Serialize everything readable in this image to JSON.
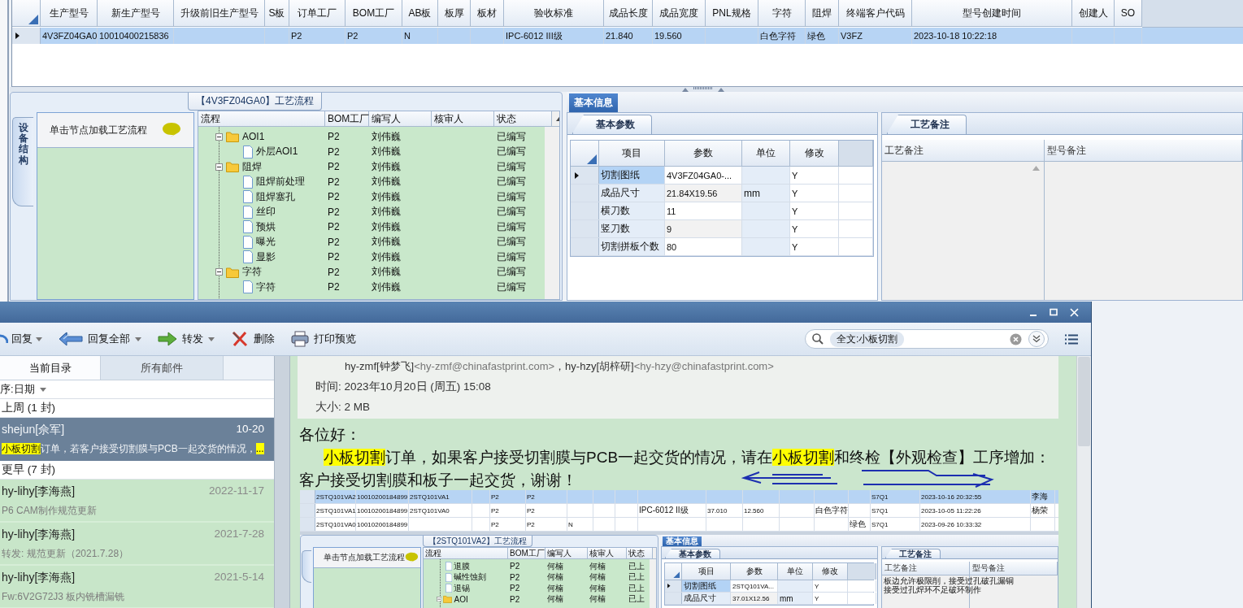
{
  "main_grid": {
    "columns": [
      "生产型号",
      "新生产型号",
      "升级前旧生产型号",
      "S板",
      "订单工厂",
      "BOM工厂",
      "AB板",
      "板厚",
      "板材",
      "验收标准",
      "成品长度",
      "成品宽度",
      "PNL规格",
      "字符",
      "阻焊",
      "终端客户代码",
      "型号创建时间",
      "创建人",
      "SO"
    ],
    "rows": [
      {
        "selected": true,
        "cells": [
          "4V3FZ04GA0",
          "10010400215836",
          null,
          null,
          "P2",
          "P2",
          "N",
          null,
          null,
          "IPC-6012 III级",
          "21.840",
          "19.560",
          null,
          "白色字符",
          "绿色",
          "V3FZ",
          "2023-10-18 10:22:18",
          null,
          null
        ]
      }
    ]
  },
  "flow_panel": {
    "title": "【4V3FZ04GA0】工艺流程",
    "side_tab": "设备结构",
    "hint": "单击节点加载工艺流程",
    "columns": [
      "流程",
      "BOM工厂",
      "编写人",
      "核审人",
      "状态"
    ],
    "tree": [
      {
        "kind": "folder",
        "name": "AOI1",
        "expanded": true,
        "cells": [
          "P2",
          "刘伟巍",
          null,
          "已编写"
        ],
        "children": [
          {
            "kind": "step",
            "name": "外层AOI1",
            "cells": [
              "P2",
              "刘伟巍",
              null,
              "已编写"
            ]
          }
        ]
      },
      {
        "kind": "folder",
        "name": "阻焊",
        "expanded": true,
        "cells": [
          "P2",
          "刘伟巍",
          null,
          "已编写"
        ],
        "children": [
          {
            "kind": "step",
            "name": "阻焊前处理",
            "cells": [
              "P2",
              "刘伟巍",
              null,
              "已编写"
            ]
          },
          {
            "kind": "step",
            "name": "阻焊塞孔",
            "cells": [
              "P2",
              "刘伟巍",
              null,
              "已编写"
            ]
          },
          {
            "kind": "step",
            "name": "丝印",
            "cells": [
              "P2",
              "刘伟巍",
              null,
              "已编写"
            ]
          },
          {
            "kind": "step",
            "name": "预烘",
            "cells": [
              "P2",
              "刘伟巍",
              null,
              "已编写"
            ]
          },
          {
            "kind": "step",
            "name": "曝光",
            "cells": [
              "P2",
              "刘伟巍",
              null,
              "已编写"
            ]
          },
          {
            "kind": "step",
            "name": "显影",
            "cells": [
              "P2",
              "刘伟巍",
              null,
              "已编写"
            ]
          }
        ]
      },
      {
        "kind": "folder",
        "name": "字符",
        "expanded": true,
        "cells": [
          "P2",
          "刘伟巍",
          null,
          "已编写"
        ],
        "children": [
          {
            "kind": "step",
            "name": "字符",
            "cells": [
              "P2",
              "刘伟巍",
              null,
              "已编写"
            ]
          }
        ]
      }
    ]
  },
  "info_panel": {
    "tab": "基本信息",
    "params_tab": "基本参数",
    "columns": [
      "项目",
      "参数",
      "单位",
      "修改"
    ],
    "rows": [
      {
        "selected": true,
        "cells": [
          "切割图纸",
          "4V3FZ04GA0-...",
          null,
          "Y"
        ]
      },
      {
        "selected": false,
        "cells": [
          "成品尺寸",
          "21.84X19.56",
          "mm",
          "Y"
        ]
      },
      {
        "selected": false,
        "cells": [
          "横刀数",
          "11",
          null,
          "Y"
        ]
      },
      {
        "selected": false,
        "cells": [
          "竖刀数",
          "9",
          null,
          "Y"
        ]
      },
      {
        "selected": false,
        "cells": [
          "切割拼板个数",
          "80",
          null,
          "Y"
        ]
      }
    ],
    "notes_tab": "工艺备注",
    "notes_columns": [
      "工艺备注",
      "型号备注"
    ]
  },
  "mail": {
    "toolbar": [
      {
        "kind": "reply",
        "label": "回复",
        "dropdown": true
      },
      {
        "kind": "reply-all",
        "label": "回复全部",
        "dropdown": true
      },
      {
        "kind": "forward",
        "label": "转发",
        "dropdown": true
      },
      {
        "kind": "delete",
        "label": "删除",
        "dropdown": false
      },
      {
        "kind": "print",
        "label": "打印预览",
        "dropdown": false
      }
    ],
    "search": {
      "tag": "全文:小板切割"
    },
    "tabs": [
      {
        "label": "当前目录",
        "selected": true
      },
      {
        "label": "所有邮件",
        "selected": false
      }
    ],
    "sort": "序:日期",
    "groups": [
      {
        "label": "上周 (1 封)",
        "messages": [
          {
            "sender": "shejun[佘军]",
            "date": "10-20",
            "selected": true,
            "preview": [
              {
                "text": "小板切割",
                "highlight": true
              },
              {
                "text": "订单，若客户接受切割膜与PCB一起交货的情况，",
                "highlight": false
              },
              {
                "text": "...",
                "highlight": true
              }
            ]
          }
        ]
      },
      {
        "label": "更早 (7 封)",
        "messages": [
          {
            "sender": "hy-lihy[李海燕]",
            "date": "2022-11-17",
            "selected": false,
            "preview": [
              {
                "text": "P6 CAM制作规范更新",
                "highlight": false
              }
            ]
          },
          {
            "sender": "hy-lihy[李海燕]",
            "date": "2021-7-28",
            "selected": false,
            "preview": [
              {
                "text": "转发: 规范更新（2021.7.28）",
                "highlight": false
              }
            ]
          },
          {
            "sender": "hy-lihy[李海燕]",
            "date": "2021-5-14",
            "selected": false,
            "preview": [
              {
                "text": "Fw:6V2G72J3 板内铣槽漏铣",
                "highlight": false
              }
            ]
          }
        ]
      }
    ],
    "reader": {
      "recipients": [
        {
          "text": "hy-zmf[钟梦飞]",
          "kind": "name"
        },
        {
          "text": "<hy-zmf@chinafastprint.com>",
          "kind": "address"
        },
        {
          "text": "，",
          "kind": "name"
        },
        {
          "text": "hy-hzy[胡梓研]",
          "kind": "name"
        },
        {
          "text": "<hy-hzy@chinafastprint.com>",
          "kind": "address"
        }
      ],
      "time": "时间: 2023年10月20日 (周五) 15:08",
      "size": "大小: 2 MB",
      "greeting": "各位好：",
      "lines": [
        [
          {
            "text": "小板切割",
            "highlight": true
          },
          {
            "text": "订单，如果客户接受切割膜与PCB一起交货的情况，请在",
            "highlight": false
          },
          {
            "text": "小板切割",
            "highlight": true
          },
          {
            "text": "和终检【外观检查】工序增加：",
            "highlight": false
          }
        ],
        [
          {
            "text": "客户接受切割膜和板子一起交货，谢谢！",
            "highlight": false
          }
        ]
      ]
    },
    "shot": {
      "rows": [
        {
          "selected": true,
          "cells": [
            "2STQ101VA2",
            "10010200184899",
            "2STQ101VA1",
            null,
            "P2",
            "P2",
            null,
            null,
            null,
            null,
            null,
            null,
            null,
            null,
            null,
            "S7Q1",
            "2023-10-16 20:32:55",
            "李海"
          ]
        },
        {
          "selected": false,
          "cells": [
            "2STQ101VA1",
            "10010200184899",
            "2STQ101VA0",
            null,
            "P2",
            "P2",
            null,
            null,
            null,
            "IPC-6012 II级",
            "37.010",
            "12.560",
            null,
            "白色字符",
            null,
            "S7Q1",
            "2023-10-05 11:22:26",
            "杨荣"
          ]
        },
        {
          "selected": false,
          "cells": [
            "2STQ101VA0",
            "10010200184899",
            null,
            null,
            "P2",
            "P2",
            "N",
            null,
            null,
            null,
            null,
            null,
            null,
            null,
            "绿色",
            "S7Q1",
            "2023-09-26 10:33:32",
            null
          ]
        }
      ],
      "flow": {
        "title": "【2STQ101VA2】工艺流程",
        "hint": "单击节点加载工艺流程",
        "columns": [
          "流程",
          "BOM工厂",
          "编写人",
          "核审人",
          "状态"
        ],
        "tree": [
          {
            "kind": "step",
            "name": "退膜",
            "cells": [
              "P2",
              "何楠",
              "何楠",
              "已上"
            ]
          },
          {
            "kind": "step",
            "name": "碱性蚀刻",
            "cells": [
              "P2",
              "何楠",
              "何楠",
              "已上"
            ]
          },
          {
            "kind": "step",
            "name": "退锡",
            "cells": [
              "P2",
              "何楠",
              "何楠",
              "已上"
            ]
          },
          {
            "kind": "folder",
            "name": "AOI",
            "expanded": true,
            "cells": [
              "P2",
              "何楠",
              "何楠",
              "已上"
            ]
          }
        ]
      },
      "info": {
        "tab": "基本信息",
        "params_tab": "基本参数",
        "columns": [
          "项目",
          "参数",
          "单位",
          "修改"
        ],
        "rows": [
          {
            "selected": true,
            "cells": [
              "切割图纸",
              "2STQ101VA...",
              null,
              "Y"
            ]
          },
          {
            "selected": false,
            "cells": [
              "成品尺寸",
              "37.01X12.56",
              "mm",
              "Y"
            ]
          }
        ],
        "notes_tab": "工艺备注",
        "notes_columns": [
          "工艺备注",
          "型号备注"
        ],
        "notes": [
          "板边允许极限削，接受过孔破孔漏铜",
          "接受过孔焊环不足破环制作"
        ]
      }
    }
  }
}
